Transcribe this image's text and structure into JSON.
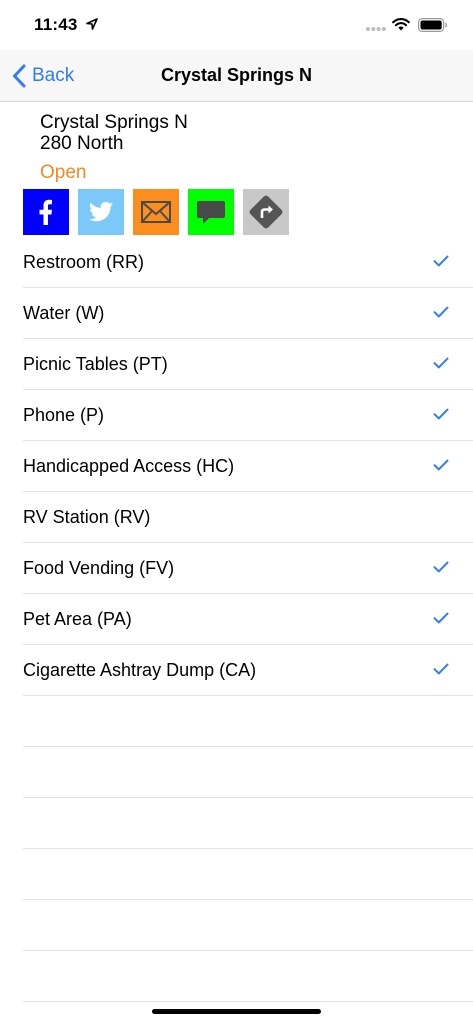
{
  "status_bar": {
    "time": "11:43"
  },
  "nav": {
    "back_label": "Back",
    "title": "Crystal Springs N"
  },
  "location": {
    "name": "Crystal Springs N",
    "highway": "280 North",
    "status": "Open",
    "status_color": "#f08a24"
  },
  "share_buttons": [
    {
      "icon": "facebook-icon",
      "color": "#0000ff"
    },
    {
      "icon": "twitter-icon",
      "color": "#7cc8f8"
    },
    {
      "icon": "email-icon",
      "color": "#fb8e1e"
    },
    {
      "icon": "sms-icon",
      "color": "#00ff00"
    },
    {
      "icon": "directions-icon",
      "color": "#c8c8c8"
    }
  ],
  "facilities": [
    {
      "label": "Restroom (RR)",
      "checked": true
    },
    {
      "label": "Water (W)",
      "checked": true
    },
    {
      "label": "Picnic Tables (PT)",
      "checked": true
    },
    {
      "label": "Phone (P)",
      "checked": true
    },
    {
      "label": "Handicapped Access (HC)",
      "checked": true
    },
    {
      "label": "RV Station (RV)",
      "checked": false
    },
    {
      "label": "Food Vending (FV)",
      "checked": true
    },
    {
      "label": "Pet Area (PA)",
      "checked": true
    },
    {
      "label": "Cigarette Ashtray Dump (CA)",
      "checked": true
    }
  ],
  "accent_color": "#2f7cf6"
}
